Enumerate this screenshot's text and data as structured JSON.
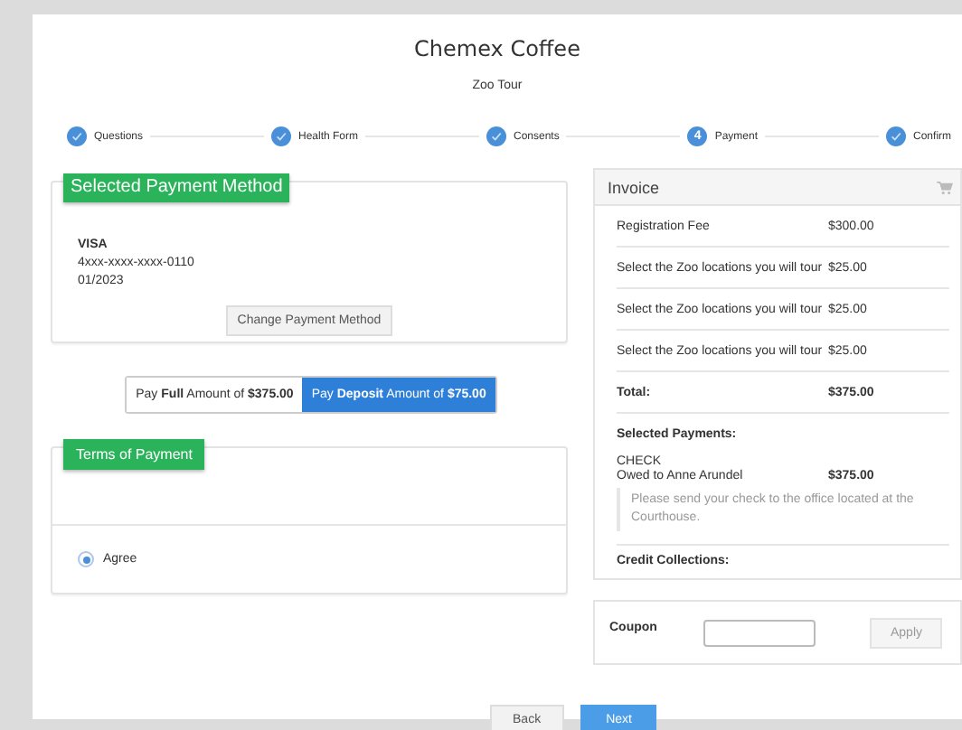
{
  "header": {
    "title": "Chemex Coffee",
    "subtitle": "Zoo Tour"
  },
  "steps": [
    {
      "label": "Questions",
      "completed": true
    },
    {
      "label": "Health Form",
      "completed": true
    },
    {
      "label": "Consents",
      "completed": true
    },
    {
      "label": "Payment",
      "completed": false,
      "number": "4"
    },
    {
      "label": "Confirm",
      "completed": true
    }
  ],
  "payment_method": {
    "heading": "Selected Payment Method",
    "card_type": "VISA",
    "card_number": "4xxx-xxxx-xxxx-0110",
    "expiry": "01/2023",
    "change_button": "Change Payment Method"
  },
  "pay_options": [
    {
      "label": "Pay **Full** Amount of **$375.00**",
      "selected": false
    },
    {
      "label": "Pay **Deposit** Amount of **$75.00**",
      "selected": true
    }
  ],
  "terms": {
    "heading": "Terms of Payment",
    "options": [
      {
        "label": "Agree",
        "selected": true
      }
    ]
  },
  "invoice": {
    "title": "Invoice",
    "rows": [
      {
        "label": "Registration Fee",
        "amount": "$300.00"
      },
      {
        "label": "Select the Zoo locations you will tour",
        "amount": "$25.00"
      },
      {
        "label": "Select the Zoo locations you will tour",
        "amount": "$25.00"
      },
      {
        "label": "Select the Zoo locations you will tour",
        "amount": "$25.00"
      }
    ],
    "total_label": "Total:",
    "total": "$375.00",
    "payments_heading": "Selected Payments:",
    "payment_type": "CHECK",
    "owed_to": "Owed to Anne Arundel",
    "owed_amount": "$375.00",
    "note": "Please send your check to the office located at the Courthouse.",
    "credit_heading": "Credit Collections:"
  },
  "coupon": {
    "label": "Coupon",
    "apply_button": "Apply"
  },
  "buttons": {
    "back": "Back",
    "next": "Next"
  }
}
